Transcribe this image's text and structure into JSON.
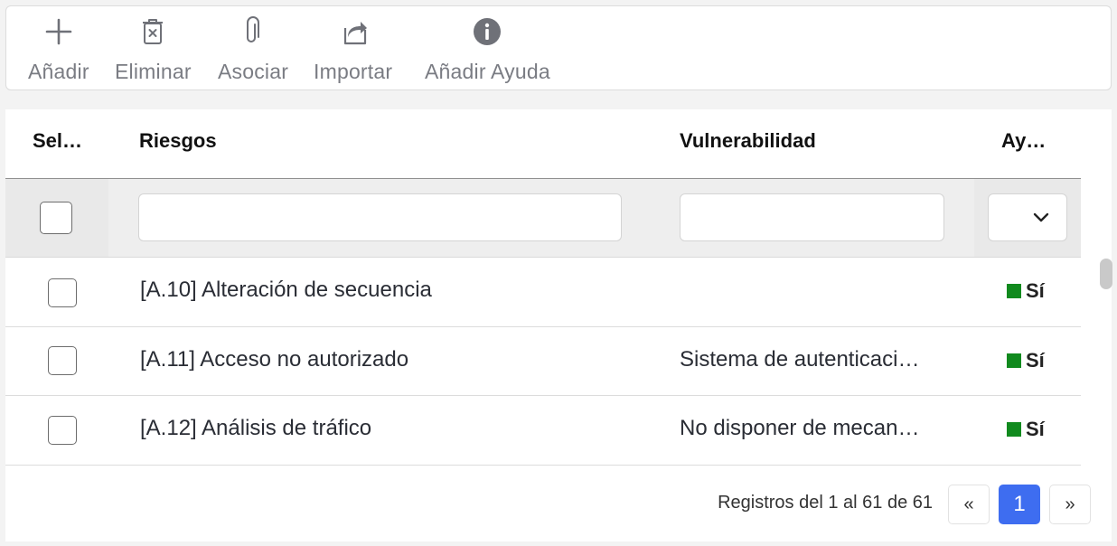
{
  "toolbar": {
    "add_label": "Añadir",
    "delete_label": "Eliminar",
    "associate_label": "Asociar",
    "import_label": "Importar",
    "add_help_label": "Añadir Ayuda"
  },
  "grid": {
    "columns": {
      "select": "Sel…",
      "risks": "Riesgos",
      "vulnerability": "Vulnerabilidad",
      "help": "Ay…"
    },
    "rows": [
      {
        "risk": "[A.10] Alteración de secuencia",
        "vulnerability": "",
        "help": "Sí"
      },
      {
        "risk": "[A.11] Acceso no autorizado",
        "vulnerability": "Sistema de autenticaci…",
        "help": "Sí"
      },
      {
        "risk": "[A.12] Análisis de tráfico",
        "vulnerability": "No disponer de mecan…",
        "help": "Sí"
      }
    ]
  },
  "pager": {
    "info": "Registros del 1 al 61 de 61",
    "prev": "«",
    "current": "1",
    "next": "»"
  },
  "colors": {
    "accent": "#3e6df0",
    "yes_marker": "#118a1e",
    "icon_gray": "#7a7c83"
  },
  "icons": [
    "plus-icon",
    "trash-icon",
    "paperclip-icon",
    "share-icon",
    "info-icon",
    "chevron-down-icon"
  ]
}
